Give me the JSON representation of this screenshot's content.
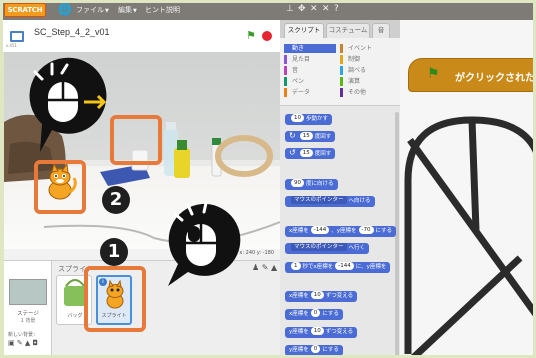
{
  "topbar": {
    "logo": "SCRATCH",
    "menus": [
      {
        "label": "ファイル"
      },
      {
        "label": "編集"
      },
      {
        "label": "ヒント"
      },
      {
        "label": "説明"
      }
    ]
  },
  "stage": {
    "project_title": "SC_Step_4_2_v01",
    "version": "v.451",
    "coords": "x: 240  y: -180"
  },
  "callouts": {
    "badge1": "1",
    "badge2": "2"
  },
  "sprites_panel": {
    "label": "スプライト",
    "stage_label": "ステージ",
    "stage_backdrops": "1 背景",
    "new_backdrop_label": "新しい背景：",
    "sprites": [
      {
        "name": "バッグ"
      },
      {
        "name": "スプライト"
      }
    ]
  },
  "tabs": [
    {
      "label": "スクリプト",
      "active": true
    },
    {
      "label": "コスチューム",
      "active": false
    },
    {
      "label": "音",
      "active": false
    }
  ],
  "categories": {
    "left": [
      {
        "label": "動き",
        "color": "#4a6cd4",
        "active": true
      },
      {
        "label": "見た目",
        "color": "#8a55d7",
        "active": false
      },
      {
        "label": "音",
        "color": "#bb42c3",
        "active": false
      },
      {
        "label": "ペン",
        "color": "#0e9a6c",
        "active": false
      },
      {
        "label": "データ",
        "color": "#ee7d16",
        "active": false
      }
    ],
    "right": [
      {
        "label": "イベント",
        "color": "#c88330",
        "active": false
      },
      {
        "label": "制御",
        "color": "#e1a91a",
        "active": false
      },
      {
        "label": "調べる",
        "color": "#2ca5e2",
        "active": false
      },
      {
        "label": "演算",
        "color": "#5cb712",
        "active": false
      },
      {
        "label": "その他",
        "color": "#632d99",
        "active": false
      }
    ]
  },
  "blocks": {
    "move": {
      "value": "10",
      "text": "歩動かす"
    },
    "turn_right": {
      "value": "15",
      "text": "度回す"
    },
    "turn_left": {
      "value": "15",
      "text": "度回す"
    },
    "point_dir": {
      "value": "90",
      "text": "度に向ける"
    },
    "point_towards": {
      "option": "マウスのポインター",
      "text": "へ向ける"
    },
    "goto_xy": {
      "x_label": "x座標を",
      "x": "-144",
      "y_label": "、y座標を",
      "y": "-70",
      "tail": "にする"
    },
    "goto": {
      "option": "マウスのポインター",
      "text": "へ行く"
    },
    "glide": {
      "value": "1",
      "mid": "秒でx座標を",
      "x": "-144",
      "tail": "に、y座標を"
    },
    "change_x": {
      "label": "x座標を",
      "value": "10",
      "text": "ずつ変える"
    },
    "set_x": {
      "label": "x座標を",
      "value": "0",
      "text": "にする"
    },
    "change_y": {
      "label": "y座標を",
      "value": "10",
      "text": "ずつ変える"
    },
    "set_y": {
      "label": "y座標を",
      "value": "0",
      "text": "にする"
    }
  },
  "script_area": {
    "hat_text": "がクリックされたとき"
  },
  "colors": {
    "highlight": "#e7793a",
    "motion": "#4a6cd4",
    "events": "#c98a1a"
  }
}
